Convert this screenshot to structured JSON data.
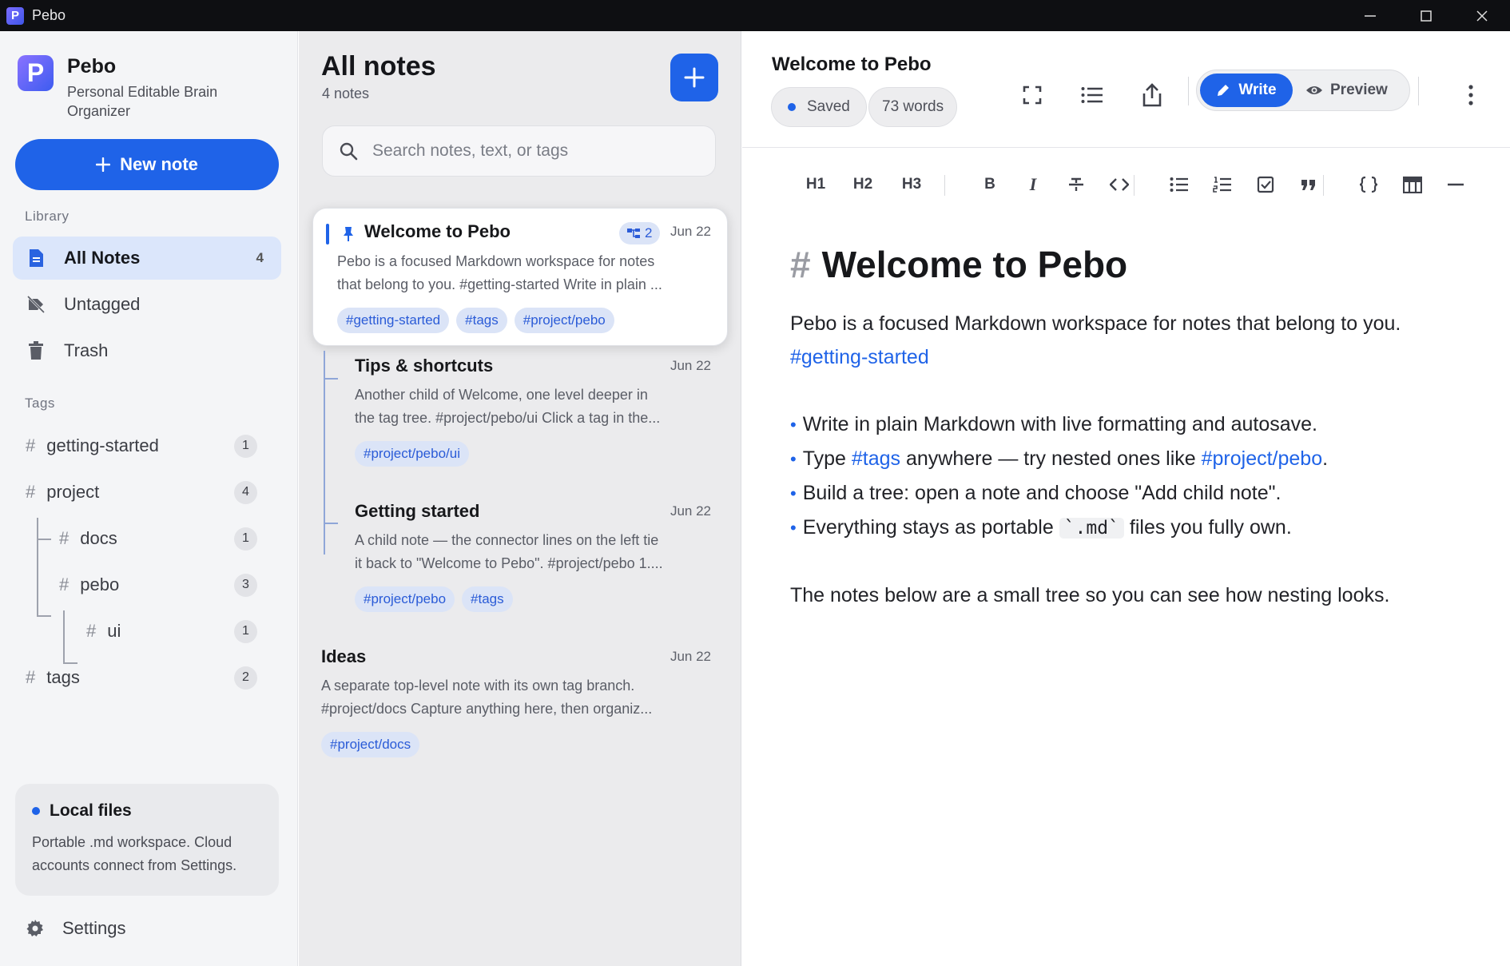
{
  "window": {
    "title": "Pebo"
  },
  "sidebar": {
    "brand_name": "Pebo",
    "brand_sub": "Personal Editable Brain Organizer",
    "new_note_label": "New note",
    "library_label": "Library",
    "nav": [
      {
        "label": "All Notes",
        "count": "4",
        "icon": "document-icon"
      },
      {
        "label": "Untagged",
        "count": "",
        "icon": "untagged-icon"
      },
      {
        "label": "Trash",
        "count": "",
        "icon": "trash-icon"
      }
    ],
    "tags_label": "Tags",
    "tags": [
      {
        "label": "getting-started",
        "count": "1"
      },
      {
        "label": "project",
        "count": "4"
      },
      {
        "label": "docs",
        "count": "1"
      },
      {
        "label": "pebo",
        "count": "3"
      },
      {
        "label": "ui",
        "count": "1"
      },
      {
        "label": "tags",
        "count": "2"
      }
    ],
    "local_files": {
      "title": "Local files",
      "body": "Portable .md workspace. Cloud accounts connect from Settings."
    },
    "settings_label": "Settings"
  },
  "notelist": {
    "title": "All notes",
    "count": "4 notes",
    "search_placeholder": "Search notes, text, or tags",
    "notes": [
      {
        "title": "Welcome to Pebo",
        "date": "Jun 22",
        "children": "2",
        "line1": "Pebo is a focused Markdown workspace for notes",
        "line2": "that belong to you. #getting-started  Write in plain ...",
        "tags": [
          "#getting-started",
          "#tags",
          "#project/pebo"
        ]
      },
      {
        "title": "Tips & shortcuts",
        "date": "Jun 22",
        "line1": "Another child of Welcome, one level deeper in",
        "line2": "the tag tree. #project/pebo/ui  Click a tag in the...",
        "tags": [
          "#project/pebo/ui"
        ]
      },
      {
        "title": "Getting started",
        "date": "Jun 22",
        "line1": "A child note — the connector lines on the left tie",
        "line2": "it back to \"Welcome to Pebo\". #project/pebo  1....",
        "tags": [
          "#project/pebo",
          "#tags"
        ]
      },
      {
        "title": "Ideas",
        "date": "Jun 22",
        "line1": "A separate top-level note with its own tag branch.",
        "line2": "#project/docs  Capture anything here, then organiz...",
        "tags": [
          "#project/docs"
        ]
      }
    ]
  },
  "editor": {
    "title": "Welcome to Pebo",
    "saved_label": "Saved",
    "words_label": "73 words",
    "write_label": "Write",
    "preview_label": "Preview",
    "toolbar": {
      "h1": "H1",
      "h2": "H2",
      "h3": "H3",
      "bold": "B",
      "italic": "I"
    },
    "doc": {
      "hash": "#",
      "h1": "Welcome to Pebo",
      "p1": "Pebo is a focused Markdown workspace for notes that belong to you.",
      "p1_tag": "#getting-started",
      "li1": "Write in plain Markdown with live formatting and autosave.",
      "li2_a": "Type ",
      "li2_tag1": "#tags",
      "li2_b": " anywhere — try nested ones like ",
      "li2_tag2": "#project/pebo",
      "li2_c": ".",
      "li3": "Build a tree: open a note and choose \"Add child note\".",
      "li4_a": "Everything stays as portable ",
      "li4_code": "`.md`",
      "li4_b": " files you fully own.",
      "p2": "The notes below are a small tree so you can see how nesting looks."
    }
  },
  "colors": {
    "accent": "#1f63e8",
    "sidebar_bg": "#f4f5f7",
    "list_bg": "#ebebed",
    "chip_bg": "#dbe4f7"
  }
}
